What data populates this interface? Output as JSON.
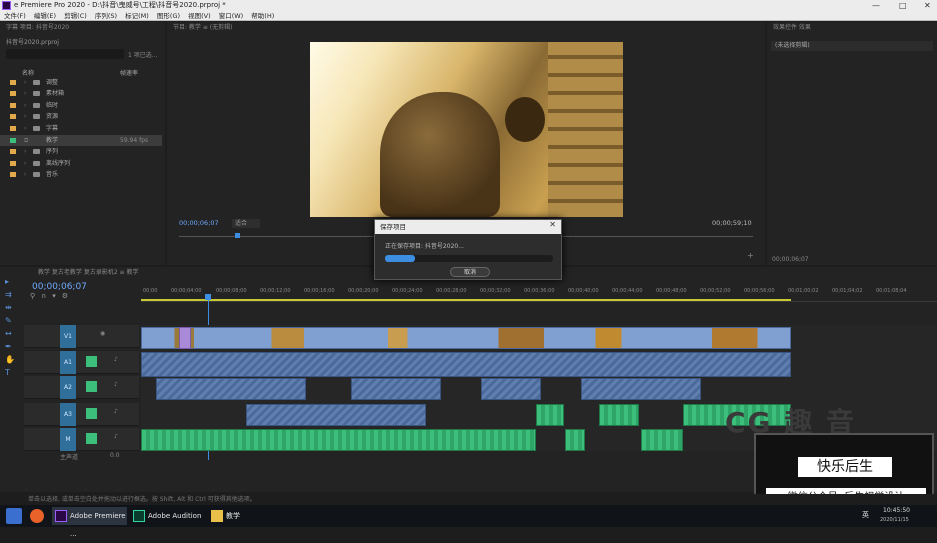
{
  "window": {
    "title": "e Premiere Pro 2020 - D:\\抖音\\曳威号\\工程\\抖音号2020.prproj *",
    "min": "—",
    "max": "□",
    "close": "✕"
  },
  "menu": [
    "文件(F)",
    "编辑(E)",
    "剪辑(C)",
    "序列(S)",
    "标记(M)",
    "图形(G)",
    "视图(V)",
    "窗口(W)",
    "帮助(H)"
  ],
  "project": {
    "tabs": "字幕    项目: 抖音号2020",
    "filename": "抖音号2020.prproj",
    "count": "1 项已选...",
    "col_name": "名称",
    "col_fps": "帧速率",
    "items": [
      {
        "name": "调整",
        "fps": ""
      },
      {
        "name": "素材箱",
        "fps": ""
      },
      {
        "name": "临时",
        "fps": ""
      },
      {
        "name": "资源",
        "fps": ""
      },
      {
        "name": "字幕",
        "fps": ""
      },
      {
        "name": "教学",
        "fps": "59.94 fps",
        "selected": true
      },
      {
        "name": "序列",
        "fps": ""
      },
      {
        "name": "离线序列",
        "fps": ""
      },
      {
        "name": "音乐",
        "fps": ""
      }
    ]
  },
  "program": {
    "tabs": "节目: 教学    ≡    (无剪辑)",
    "timecode": "00;00;06;07",
    "fit": "适合",
    "duration": "00;00;59;10"
  },
  "effects": {
    "tabs": "效果控件    效果",
    "noclip": "(未选择剪辑)",
    "timecode": "00;00;06;07"
  },
  "timeline": {
    "tabs": "教学    复古老教学    复古录影机2    ≡ 教学",
    "timecode": "00;00;06;07",
    "ruler": [
      "00;00",
      "00;00;04;00",
      "00;00;08;00",
      "00;00;12;00",
      "00;00;16;00",
      "00;00;20;00",
      "00;00;24;00",
      "00;00;28;00",
      "00;00;32;00",
      "00;00;36;00",
      "00;00;40;00",
      "00;00;44;00",
      "00;00;48;00",
      "00;00;52;00",
      "00;00;56;00",
      "00;01;00;02",
      "00;01;04;02",
      "00;01;08;04"
    ],
    "tracks": [
      "V1",
      "A1",
      "A2",
      "A3",
      "A4",
      "M"
    ],
    "master": "主声道",
    "master_val": "0.0"
  },
  "dialog": {
    "title": "保存项目",
    "message": "正在保存项目: 抖音号2020...",
    "progress": 0.18,
    "cancel": "取消"
  },
  "watermark": {
    "line1": "快乐后生",
    "line2": "微信公众号: 后生视觉设计",
    "big": "CG 趣 音"
  },
  "status": "单击以选择, 或单击空白处并拖动以进行框选。按 Shift, Alt 和 Ctrl 可获得其他选项。",
  "taskbar": {
    "apps": [
      "Adobe Premiere ...",
      "Adobe Audition",
      "教学"
    ],
    "time": "10:45:50",
    "date": "2020/11/15",
    "lang": "英"
  },
  "colors": {
    "accent": "#3d8ee0",
    "video_clip": "#7fa0d0",
    "audio_clip": "#5e7fb0",
    "music_clip": "#3bbf7a",
    "folder": "#e2a94b"
  }
}
